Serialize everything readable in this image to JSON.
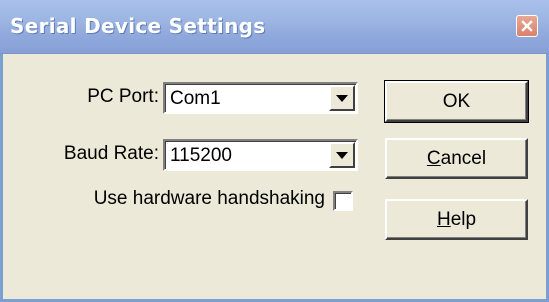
{
  "window": {
    "title": "Serial Device Settings",
    "close_icon": "close-icon"
  },
  "form": {
    "pc_port": {
      "label": "PC Port:",
      "value": "Com1"
    },
    "baud_rate": {
      "label": "Baud Rate:",
      "value": "115200"
    },
    "handshaking": {
      "label": "Use hardware handshaking",
      "checked": false
    }
  },
  "buttons": {
    "ok": "OK",
    "cancel_first": "C",
    "cancel_rest": "ancel",
    "help_first": "H",
    "help_rest": "elp"
  },
  "colors": {
    "titlebar": "#9db6e3",
    "face": "#ece9d8",
    "close": "#d9826a"
  }
}
